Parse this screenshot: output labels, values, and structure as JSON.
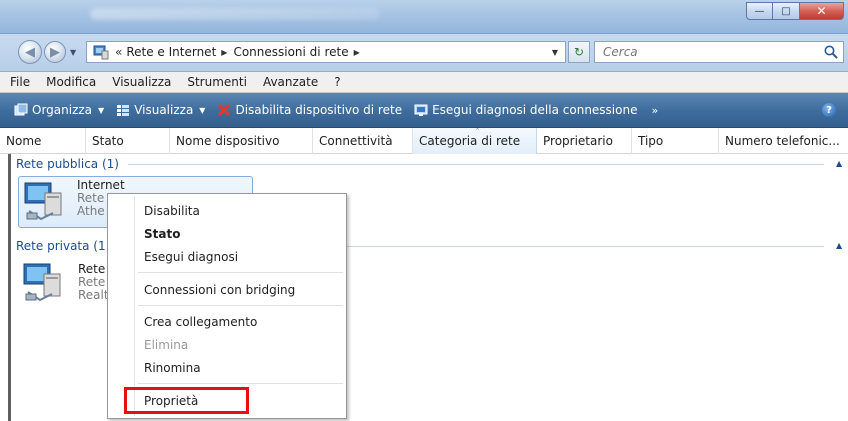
{
  "address": {
    "overflow": "«",
    "crumbs": [
      "Rete e Internet",
      "Connessioni di rete"
    ],
    "search_placeholder": "Cerca"
  },
  "menubar": [
    "File",
    "Modifica",
    "Visualizza",
    "Strumenti",
    "Avanzate",
    "?"
  ],
  "commandbar": {
    "organize": "Organizza",
    "view": "Visualizza",
    "disable": "Disabilita dispositivo di rete",
    "diagnose": "Esegui diagnosi della connessione",
    "more": "»"
  },
  "columns": [
    "Nome",
    "Stato",
    "Nome dispositivo",
    "Connettività",
    "Categoria di rete",
    "Proprietario",
    "Tipo",
    "Numero telefonic..."
  ],
  "groups": {
    "public": {
      "label": "Rete pubblica (1)",
      "item": {
        "name": "Internet",
        "line2": "Rete",
        "line3": "Athe"
      }
    },
    "private": {
      "label": "Rete privata (1",
      "item": {
        "name": "Rete",
        "line2": "Rete",
        "line3": "Realt"
      }
    }
  },
  "context_menu": {
    "disable": "Disabilita",
    "status": "Stato",
    "diagnose": "Esegui diagnosi",
    "bridge": "Connessioni con bridging",
    "shortcut": "Crea collegamento",
    "delete": "Elimina",
    "rename": "Rinomina",
    "properties": "Proprietà"
  },
  "colors": {
    "highlight_box": "#e60f14",
    "group_header": "#1c4b8f",
    "command_bar": "#3f6e9e"
  }
}
